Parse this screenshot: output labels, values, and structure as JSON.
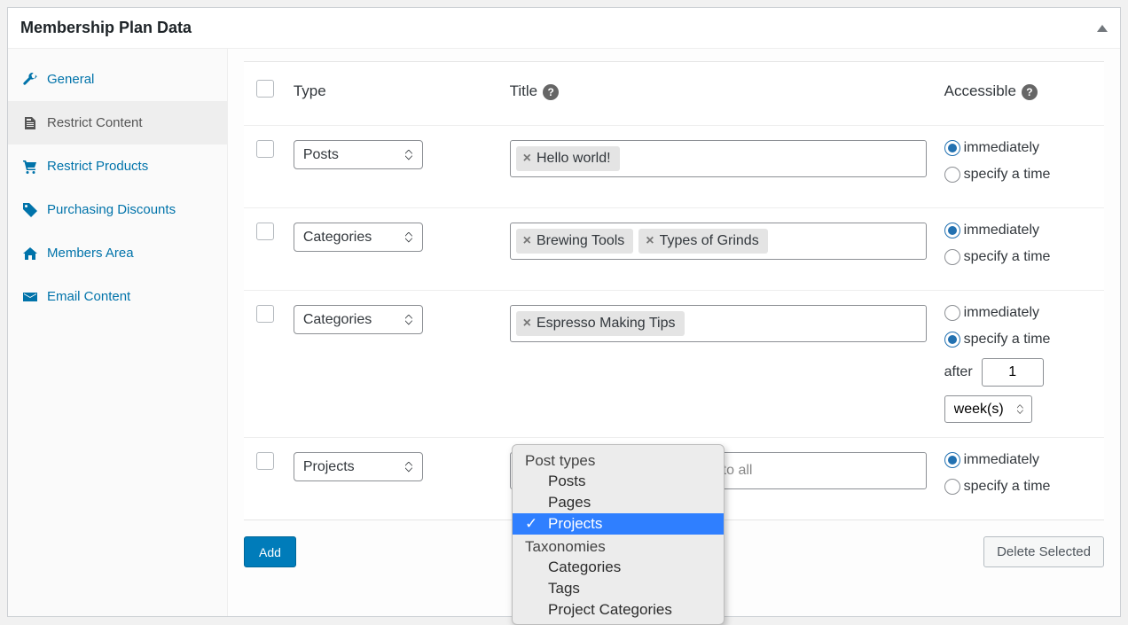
{
  "panel_title": "Membership Plan Data",
  "sidebar": {
    "items": [
      {
        "icon": "wrench",
        "label": "General"
      },
      {
        "icon": "page",
        "label": "Restrict Content",
        "active": true
      },
      {
        "icon": "cart",
        "label": "Restrict Products"
      },
      {
        "icon": "tag",
        "label": "Purchasing Discounts"
      },
      {
        "icon": "home",
        "label": "Members Area"
      },
      {
        "icon": "mail",
        "label": "Email Content"
      }
    ]
  },
  "columns": {
    "type": "Type",
    "title": "Title",
    "accessible": "Accessible"
  },
  "rows": [
    {
      "type": "Posts",
      "tags": [
        {
          "label": "Hello world!"
        }
      ],
      "placeholder": "",
      "accessible": {
        "mode": "immediately"
      }
    },
    {
      "type": "Categories",
      "tags": [
        {
          "label": "Brewing Tools"
        },
        {
          "label": "Types of Grinds"
        }
      ],
      "placeholder": "",
      "accessible": {
        "mode": "immediately"
      }
    },
    {
      "type": "Categories",
      "tags": [
        {
          "label": "Espresso Making Tips"
        }
      ],
      "placeholder": "",
      "accessible": {
        "mode": "specify",
        "after_label": "after",
        "value": "1",
        "unit": "week(s)"
      }
    },
    {
      "type": "Projects",
      "tags": [],
      "placeholder": "Search... or leave blank to apply to all",
      "accessible": {
        "mode": "immediately"
      }
    }
  ],
  "radio_labels": {
    "immediately": "immediately",
    "specify": "specify a time"
  },
  "dropdown": {
    "groups": [
      {
        "label": "Post types",
        "options": [
          "Posts",
          "Pages",
          "Projects"
        ]
      },
      {
        "label": "Taxonomies",
        "options": [
          "Categories",
          "Tags",
          "Project Categories"
        ]
      }
    ],
    "selected": "Projects"
  },
  "footer": {
    "add": "Add",
    "delete": "Delete Selected"
  }
}
